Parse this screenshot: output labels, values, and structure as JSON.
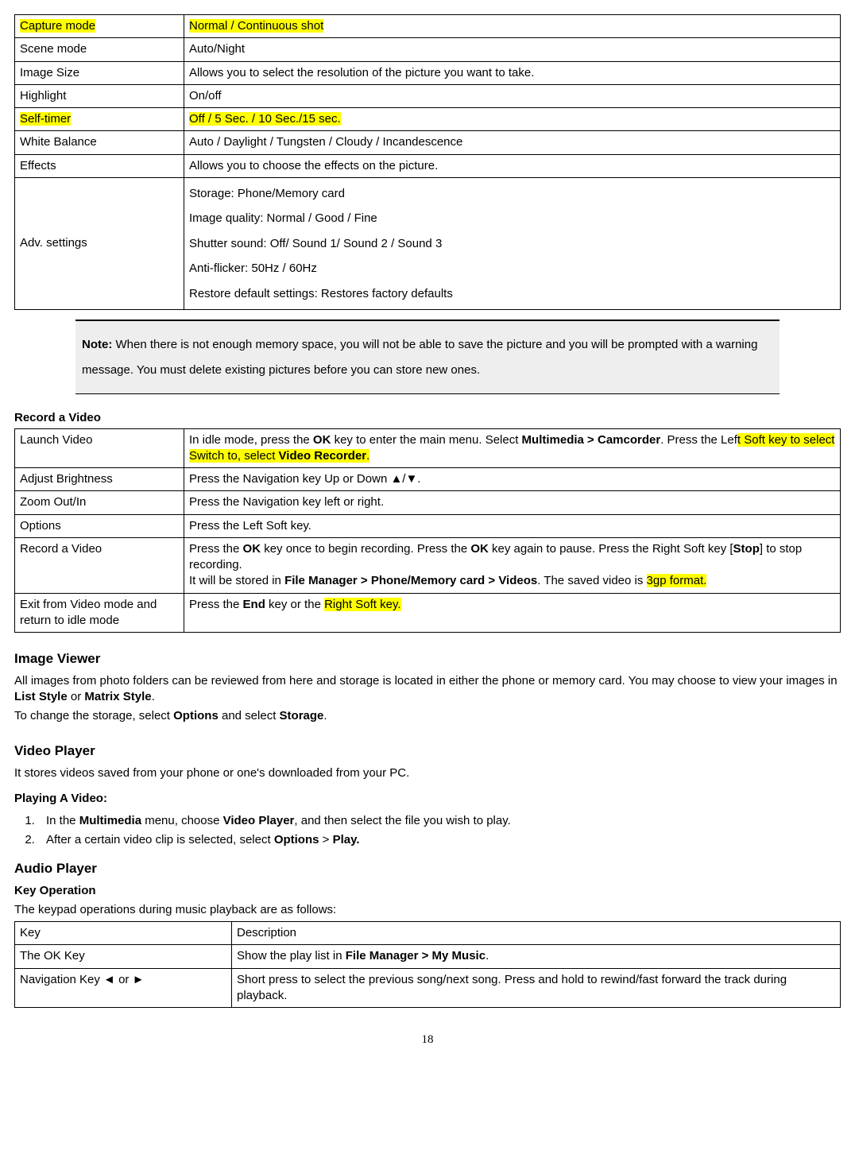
{
  "t1": {
    "r0": {
      "a": "Capture mode",
      "b": "Normal / Continuous shot   "
    },
    "r1": {
      "a": "Scene mode",
      "b": "Auto/Night"
    },
    "r2": {
      "a": "Image Size",
      "b": "Allows you to select the resolution of the picture you want to take."
    },
    "r3": {
      "a": "Highlight",
      "b": "On/off"
    },
    "r4": {
      "a": "Self-timer",
      "b": "Off / 5 Sec. / 10 Sec./15 sec."
    },
    "r5": {
      "a": "White Balance",
      "b": "Auto / Daylight / Tungsten / Cloudy / Incandescence"
    },
    "r6": {
      "a": "Effects",
      "b": "Allows you to choose the effects on the picture."
    },
    "r7": {
      "a": "Adv. settings",
      "l1": "Storage: Phone/Memory card",
      "l2": "Image quality: Normal / Good / Fine",
      "l3": "Shutter sound: Off/ Sound 1/ Sound 2 / Sound 3",
      "l4": "Anti-flicker: 50Hz / 60Hz",
      "l5": "Restore default settings: Restores factory defaults"
    }
  },
  "note": {
    "label": "Note:",
    "text": " When there is not enough memory space, you will not be able to save the picture and you will be prompted with a warning message. You must delete existing pictures before you can store new ones."
  },
  "record_head": "Record a Video",
  "t2": {
    "r0": {
      "a": "Launch Video",
      "p1": "In idle mode, press the ",
      "p2": "OK",
      "p3": " key to enter the main menu. Select ",
      "p4": "Multimedia > Camcorder",
      "p5": ". Press the Lef",
      "p6": "t Soft key to select Switch to, select ",
      "p7": "Video Recorder",
      "p8": "."
    },
    "r1": {
      "a": "Adjust Brightness",
      "b": "Press the Navigation key Up or Down ▲/▼."
    },
    "r2": {
      "a": "Zoom Out/In",
      "b": "Press the Navigation key left or right."
    },
    "r3": {
      "a": "Options",
      "b": "Press the Left Soft key."
    },
    "r4": {
      "a": "Record a Video",
      "p1": "Press the ",
      "p2": "OK",
      "p3": " key once to begin recording. Press the ",
      "p4": "OK",
      "p5": " key again to pause. Press the Right Soft key [",
      "p6": "Stop",
      "p7": "] to stop recording.",
      "p8": "It will be stored in ",
      "p9": "File Manager > Phone/Memory card > Videos",
      "p10": ". The saved video is ",
      "p11": "3gp format."
    },
    "r5": {
      "a": "Exit from Video mode and return to idle mode",
      "p1": "Press the ",
      "p2": "End",
      "p3": " key or the ",
      "p4": "Right Soft key."
    }
  },
  "iv_head": "Image Viewer",
  "iv_p1a": "All images from photo folders can be reviewed from here and storage is located in either the phone or memory card. You may choose to view your images in ",
  "iv_p1b": "List Style",
  "iv_p1c": " or ",
  "iv_p1d": "Matrix Style",
  "iv_p1e": ".",
  "iv_p2a": "To change the storage, select ",
  "iv_p2b": "Options",
  "iv_p2c": " and select ",
  "iv_p2d": "Storage",
  "iv_p2e": ".",
  "vp_head": "Video Player",
  "vp_p1": "It stores videos saved from your phone or one's downloaded from your PC.",
  "vp_sub": "Playing A Video:",
  "vp_li1a": "In the ",
  "vp_li1b": "Multimedia",
  "vp_li1c": " menu, choose ",
  "vp_li1d": "Video Player",
  "vp_li1e": ", and then select the file you wish to play.",
  "vp_li2a": "After a certain video clip is selected, select ",
  "vp_li2b": "Options",
  "vp_li2c": " > ",
  "vp_li2d": "Play.",
  "ap_head": "Audio Player",
  "ap_sub": "Key Operation",
  "ap_intro": "The keypad operations during music playback are as follows:",
  "t3": {
    "r0": {
      "a": "Key",
      "b": "Description"
    },
    "r1": {
      "a": "The OK Key",
      "p1": "Show the play list in ",
      "p2": "File Manager > My Music",
      "p3": "."
    },
    "r2": {
      "a": "Navigation Key ◄ or ►",
      "b": "Short press to select the previous song/next song. Press and hold to rewind/fast forward the track during playback."
    }
  },
  "pagenum": "18"
}
